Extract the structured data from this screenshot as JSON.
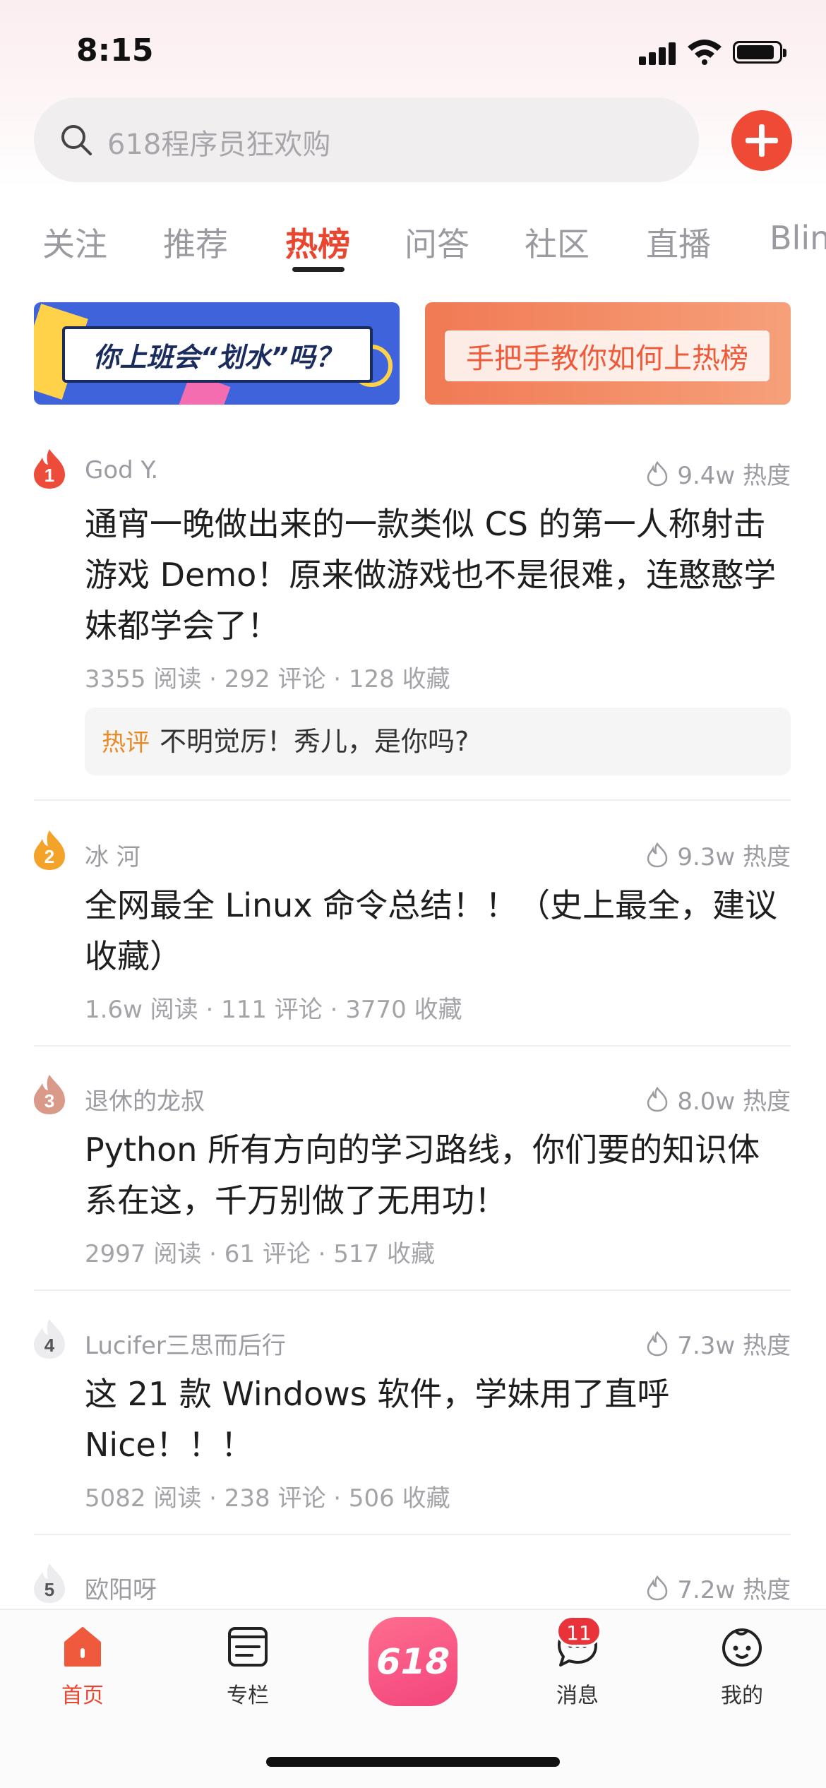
{
  "status_bar": {
    "time": "8:15"
  },
  "search": {
    "placeholder": "618程序员狂欢购"
  },
  "tabs": [
    {
      "label": "关注"
    },
    {
      "label": "推荐"
    },
    {
      "label": "热榜"
    },
    {
      "label": "问答"
    },
    {
      "label": "社区"
    },
    {
      "label": "直播"
    },
    {
      "label": "Blin"
    }
  ],
  "banners": [
    {
      "text": "你上班会“划水”吗？"
    },
    {
      "text": "手把手教你如何上热榜"
    }
  ],
  "articles": [
    {
      "rank": "1",
      "author": "God Y.",
      "heat": "9.4w 热度",
      "title": "通宵一晚做出来的一款类似 CS 的第一人称射击游戏 Demo！原来做游戏也不是很难，连憨憨学妹都学会了！",
      "stats": "3355 阅读 · 292 评论 · 128 收藏",
      "hot_comment": {
        "tag": "热评",
        "text": "不明觉厉！秀儿，是你吗?"
      }
    },
    {
      "rank": "2",
      "author": "冰 河",
      "heat": "9.3w 热度",
      "title": "全网最全 Linux 命令总结！！（史上最全，建议收藏）",
      "stats": "1.6w 阅读 · 111 评论 · 3770 收藏"
    },
    {
      "rank": "3",
      "author": "退休的龙叔",
      "heat": "8.0w 热度",
      "title": "Python 所有方向的学习路线，你们要的知识体系在这，千万别做了无用功！",
      "stats": "2997 阅读 · 61 评论 · 517 收藏"
    },
    {
      "rank": "4",
      "author": "Lucifer三思而后行",
      "heat": "7.3w 热度",
      "title": "这 21 款 Windows 软件，学妹用了直呼 Nice！！！",
      "stats": "5082 阅读 · 238 评论 · 506 收藏"
    },
    {
      "rank": "5",
      "author": "欧阳呀",
      "heat": "7.2w 热度"
    }
  ],
  "bottom_nav": {
    "home": "首页",
    "column": "专栏",
    "promo": "618",
    "messages": "消息",
    "messages_badge": "11",
    "mine": "我的"
  },
  "colors": {
    "accent": "#e9452f",
    "add_button": "#ef4a35",
    "hot_tag": "#e98a24"
  }
}
